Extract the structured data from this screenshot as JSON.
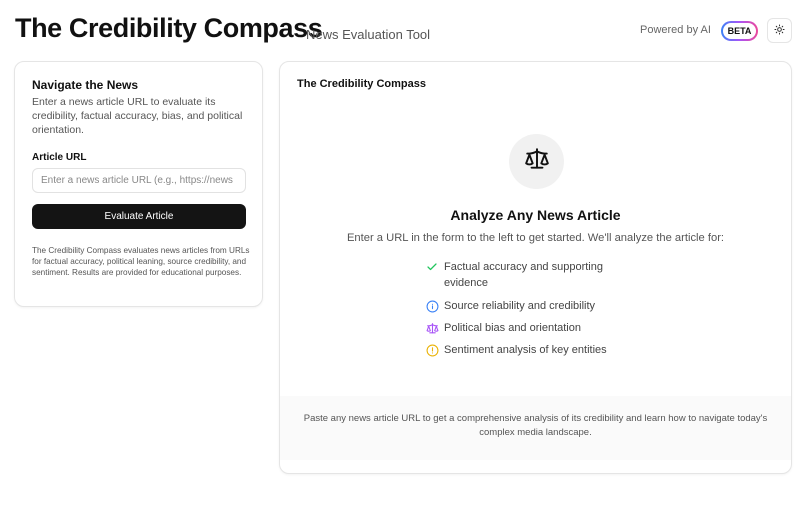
{
  "header": {
    "title": "The Credibility Compass",
    "subtitle": "News Evaluation Tool",
    "powered_by": "Powered by AI",
    "badge": "BETA",
    "theme_icon": "sun-icon"
  },
  "form_panel": {
    "title": "Navigate the News",
    "description": "Enter a news article URL to evaluate its credibility, factual accuracy, bias, and political orientation.",
    "field_label": "Article URL",
    "url_value": "",
    "url_placeholder": "Enter a news article URL (e.g., https://news",
    "submit_label": "Evaluate Article",
    "footnote": "The Credibility Compass evaluates news articles from URLs for factual accuracy, political leaning, source credibility, and sentiment. Results are provided for educational purposes."
  },
  "results_panel": {
    "title": "The Credibility Compass",
    "hero_icon": "scale-icon",
    "hero_title": "Analyze Any News Article",
    "hero_subtitle": "Enter a URL in the form to the left to get started. We'll analyze the article for:",
    "features": [
      {
        "icon": "check-icon",
        "color": "#22c55e",
        "label": "Factual accuracy and supporting evidence"
      },
      {
        "icon": "info-circle-icon",
        "color": "#3b82f6",
        "label": "Source reliability and credibility"
      },
      {
        "icon": "scale-icon",
        "color": "#a855f7",
        "label": "Political bias and orientation"
      },
      {
        "icon": "alert-circle-icon",
        "color": "#eab308",
        "label": "Sentiment analysis of key entities"
      }
    ],
    "footer_text": "Paste any news article URL to get a comprehensive analysis of its credibility and learn how to navigate today's complex media landscape."
  },
  "colors": {
    "button_bg": "#141414",
    "badge_gradient": [
      "#3b82f6",
      "#a855f7",
      "#ec4899"
    ]
  }
}
